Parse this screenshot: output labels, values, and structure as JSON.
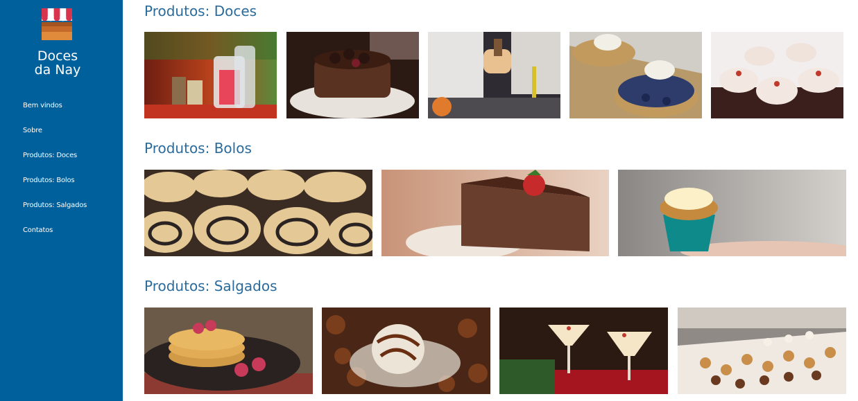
{
  "brand": {
    "title": "Doces da Nay"
  },
  "nav": {
    "items": [
      {
        "label": "Bem vindos"
      },
      {
        "label": "Sobre"
      },
      {
        "label": "Produtos: Doces"
      },
      {
        "label": "Produtos: Bolos"
      },
      {
        "label": "Produtos: Salgados"
      },
      {
        "label": "Contatos"
      }
    ]
  },
  "sections": {
    "doces": {
      "title": "Produtos: Doces",
      "photos": [
        "candy-jars-photo",
        "berry-cake-photo",
        "chef-plating-photo",
        "blueberry-tart-photo",
        "cupcakes-photo"
      ]
    },
    "bolos": {
      "title": "Produtos: Bolos",
      "photos": [
        "poppy-seed-rolls-photo",
        "chocolate-cake-slice-photo",
        "cupcake-in-hand-photo"
      ]
    },
    "salgados": {
      "title": "Produtos: Salgados",
      "photos": [
        "pancakes-raspberries-photo",
        "chocolate-coconut-dessert-photo",
        "christmas-cocktails-photo",
        "pastry-counter-photo"
      ]
    }
  },
  "colors": {
    "sidebar": "#00609b",
    "heading": "#2a6b9c"
  }
}
